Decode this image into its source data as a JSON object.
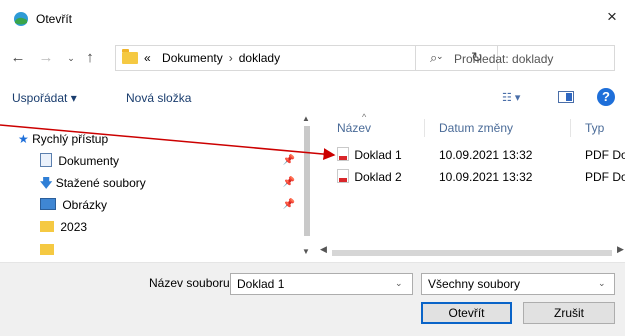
{
  "window": {
    "title": "Otevřít",
    "close_glyph": "×"
  },
  "nav": {
    "back": "←",
    "forward": "→",
    "recent": "⌄",
    "up": "↑"
  },
  "address": {
    "prefix": "«",
    "crumbs": [
      "Dokumenty",
      "doklady"
    ],
    "separator": "›",
    "dropdown": "⌄",
    "refresh": "↻"
  },
  "search": {
    "icon": "⌕",
    "placeholder": "Prohledat: doklady"
  },
  "toolbar": {
    "organize": "Uspořádat ▾",
    "new_folder": "Nová složka",
    "view": "☷ ▾",
    "help": "?"
  },
  "sidebar": {
    "items": [
      {
        "label": "Rychlý přístup",
        "icon": "star-icon",
        "pinned": false
      },
      {
        "label": "Dokumenty",
        "icon": "document-icon",
        "pinned": true
      },
      {
        "label": "Stažené soubory",
        "icon": "download-icon",
        "pinned": true
      },
      {
        "label": "Obrázky",
        "icon": "image-icon",
        "pinned": true
      },
      {
        "label": "2023",
        "icon": "folder-icon",
        "pinned": false
      }
    ],
    "pin_glyph": "📌"
  },
  "columns": {
    "name": "Název",
    "date": "Datum změny",
    "type": "Typ"
  },
  "files": [
    {
      "name": "Doklad 1",
      "date": "10.09.2021 13:32",
      "type": "PDF Do"
    },
    {
      "name": "Doklad 2",
      "date": "10.09.2021 13:32",
      "type": "PDF Do"
    }
  ],
  "bottom": {
    "filename_label": "Název souboru:",
    "filename_value": "Doklad 1",
    "filetype_value": "Všechny soubory",
    "open_label": "Otevřít",
    "cancel_label": "Zrušit"
  },
  "colors": {
    "accent": "#0a64c8",
    "annotation_arrow": "#cc0000",
    "folder": "#f5c942"
  }
}
